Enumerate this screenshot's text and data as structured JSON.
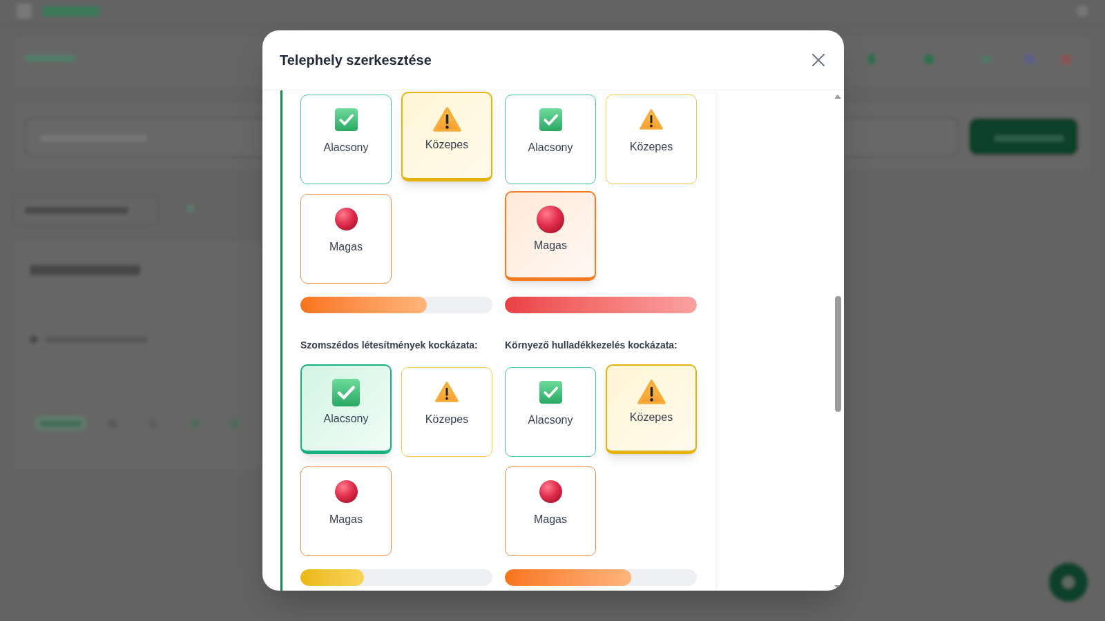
{
  "dialog": {
    "title": "Telephely szerkesztése"
  },
  "risk_groups": [
    {
      "options": [
        {
          "label": "Alacsony",
          "kind": "low",
          "selected": false
        },
        {
          "label": "Közepes",
          "kind": "medium",
          "selected": true
        },
        {
          "label": "Magas",
          "kind": "high",
          "selected": false
        }
      ],
      "level": 0.66
    },
    {
      "options": [
        {
          "label": "Alacsony",
          "kind": "low",
          "selected": false
        },
        {
          "label": "Közepes",
          "kind": "medium",
          "selected": false
        },
        {
          "label": "Magas",
          "kind": "high",
          "selected": true
        }
      ],
      "level": 1
    },
    {
      "label": "Szomszédos létesítmények kockázata:",
      "options": [
        {
          "label": "Alacsony",
          "kind": "low",
          "selected": true
        },
        {
          "label": "Közepes",
          "kind": "medium",
          "selected": false
        },
        {
          "label": "Magas",
          "kind": "high",
          "selected": false
        }
      ],
      "level": 0.33
    },
    {
      "label": "Környező hulladékkezelés kockázata:",
      "options": [
        {
          "label": "Alacsony",
          "kind": "low",
          "selected": false
        },
        {
          "label": "Közepes",
          "kind": "medium",
          "selected": true
        },
        {
          "label": "Magas",
          "kind": "high",
          "selected": false
        }
      ],
      "level": 0.66
    }
  ]
}
